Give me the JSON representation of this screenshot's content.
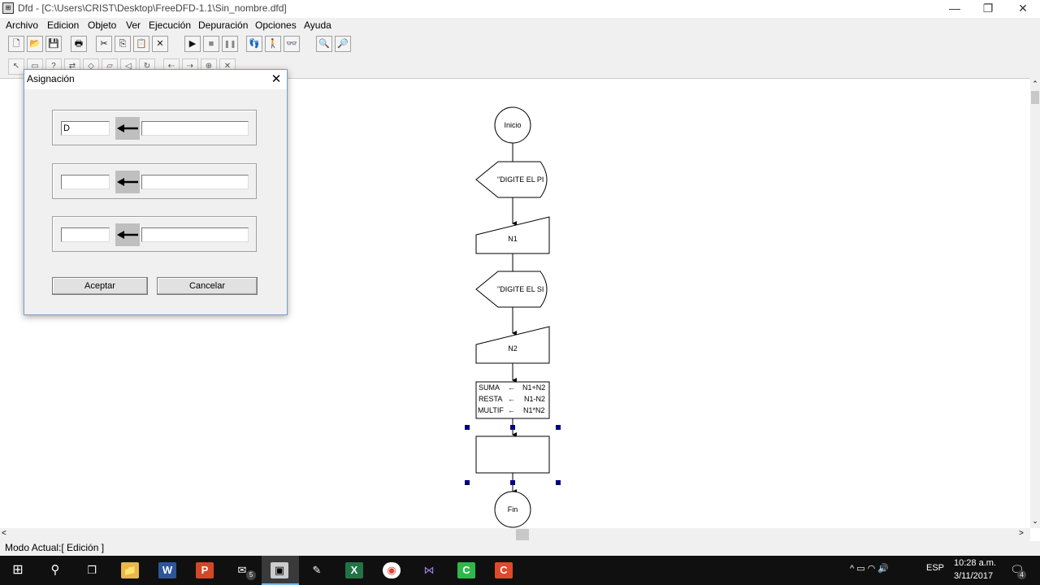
{
  "window": {
    "title": "Dfd - [C:\\Users\\CRIST\\Desktop\\FreeDFD-1.1\\Sin_nombre.dfd]",
    "minimize": "—",
    "restore": "❐",
    "close": "✕"
  },
  "menu": [
    "Archivo",
    "Edicion",
    "Objeto",
    "Ver",
    "Ejecución",
    "Depuración",
    "Opciones",
    "Ayuda"
  ],
  "toolbar": {
    "new": "🗋",
    "open": "📂",
    "save": "💾",
    "print": "🖶",
    "cut": "✂",
    "copy": "⎘",
    "paste": "📋",
    "delete": "✕",
    "run": "▶",
    "stop": "■",
    "pause": "❚❚",
    "debug_step": "👣",
    "debug_run": "🚶",
    "watch": "👓",
    "zoom_out": "🔍",
    "zoom_in": "🔎"
  },
  "toolbar2": [
    "↖",
    "▭",
    "?",
    "⇄",
    "◇",
    "▱",
    "◁",
    "↻",
    "⇠",
    "⇢",
    "⊕",
    "✕"
  ],
  "dialog": {
    "title": "Asignación",
    "close": "✕",
    "rows": [
      {
        "variable": "D",
        "expression": ""
      },
      {
        "variable": "",
        "expression": ""
      },
      {
        "variable": "",
        "expression": ""
      }
    ],
    "arrow": "⟵",
    "ok": "Aceptar",
    "cancel": "Cancelar"
  },
  "flowchart": {
    "start": "Inicio",
    "output1": "\"DIGITE EL PI",
    "read1": "N1",
    "output2": "\"DIGITE EL SI",
    "read2": "N2",
    "assign": [
      {
        "var": "SUMA",
        "arrow": "←",
        "expr": "N1+N2"
      },
      {
        "var": "RESTA",
        "arrow": "←",
        "expr": "N1-N2"
      },
      {
        "var": "MULTIF",
        "arrow": "←",
        "expr": "N1*N2"
      }
    ],
    "end": "Fin"
  },
  "status": "Modo Actual:[ Edición ]",
  "taskbar": {
    "apps": [
      "⊞",
      "⚲",
      "❐",
      "📁",
      "W",
      "P",
      "✉",
      "▣",
      "✎",
      "X",
      "◉",
      "⋈",
      "C",
      "C"
    ],
    "mail_badge": "5",
    "tray_icons": "^  ▭  ◠  🔊",
    "lang": "ESP",
    "time": "10:28 a.m.",
    "date": "3/11/2017",
    "notif_badge": "4"
  },
  "colors": {
    "selection_handle": "#00007f",
    "dialog_border": "#7a9cc8",
    "taskbar": "#101010"
  }
}
